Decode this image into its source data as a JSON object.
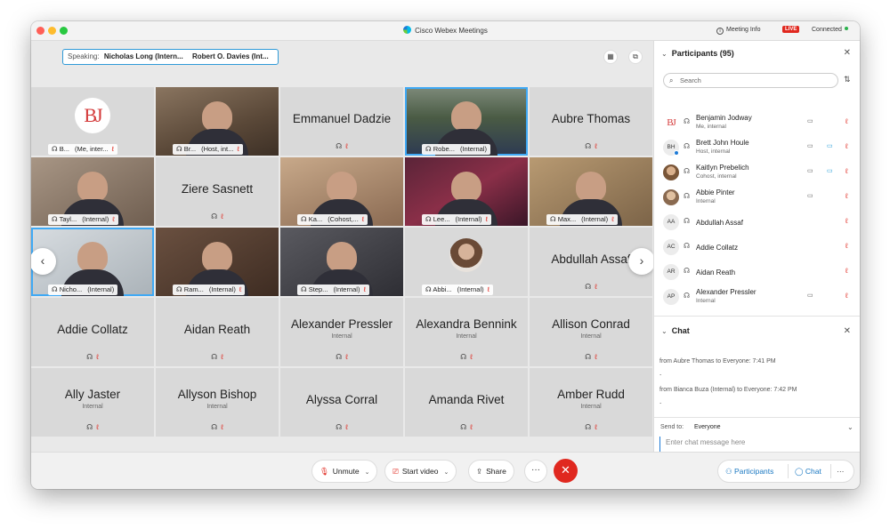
{
  "window": {
    "title": "Cisco Webex Meetings",
    "meeting_info": "Meeting Info",
    "live": "LIVE",
    "status": "Connected"
  },
  "speaking": {
    "label": "Speaking:",
    "names": [
      "Nicholas Long (Intern...",
      "Robert O. Davies (Int..."
    ]
  },
  "tiles": [
    {
      "type": "logo",
      "label": "B...",
      "extra": "(Me, inter...",
      "muted": true
    },
    {
      "type": "video",
      "label": "Br...",
      "extra": "(Host, int...",
      "muted": true
    },
    {
      "type": "name",
      "name": "Emmanuel Dadzie",
      "muted": true
    },
    {
      "type": "video",
      "label": "Robe...",
      "extra": "(Internal)",
      "muted": false
    },
    {
      "type": "name",
      "name": "Aubre Thomas",
      "muted": true
    },
    {
      "type": "video",
      "label": "Tayl...",
      "extra": "(Internal)",
      "muted": true
    },
    {
      "type": "name",
      "name": "Ziere Sasnett",
      "muted": true
    },
    {
      "type": "video",
      "label": "Ka...",
      "extra": "(Cohost,...",
      "muted": true
    },
    {
      "type": "video",
      "label": "Lee...",
      "extra": "(Internal)",
      "muted": true
    },
    {
      "type": "video",
      "label": "Max...",
      "extra": "(Internal)",
      "muted": true
    },
    {
      "type": "video",
      "label": "Nicho...",
      "extra": "(Internal)",
      "muted": false
    },
    {
      "type": "video",
      "label": "Ram...",
      "extra": "(Internal)",
      "muted": true
    },
    {
      "type": "video",
      "label": "Step...",
      "extra": "(Internal)",
      "muted": true
    },
    {
      "type": "avatar",
      "label": "Abbi...",
      "extra": "(Internal)",
      "muted": true
    },
    {
      "type": "name",
      "name": "Abdullah Assaf",
      "muted": true
    },
    {
      "type": "name",
      "name": "Addie Collatz",
      "muted": true
    },
    {
      "type": "name",
      "name": "Aidan Reath",
      "muted": true
    },
    {
      "type": "name",
      "name": "Alexander Pressler",
      "sub": "Internal",
      "muted": true
    },
    {
      "type": "name",
      "name": "Alexandra Bennink",
      "sub": "Internal",
      "muted": true
    },
    {
      "type": "name",
      "name": "Allison Conrad",
      "sub": "Internal",
      "muted": true
    },
    {
      "type": "name",
      "name": "Ally Jaster",
      "sub": "Internal",
      "muted": true
    },
    {
      "type": "name",
      "name": "Allyson Bishop",
      "sub": "Internal",
      "muted": true
    },
    {
      "type": "name",
      "name": "Alyssa Corral",
      "muted": true
    },
    {
      "type": "name",
      "name": "Amanda Rivet",
      "muted": true
    },
    {
      "type": "name",
      "name": "Amber Rudd",
      "sub": "Internal",
      "muted": true
    }
  ],
  "toolbar": {
    "unmute": "Unmute",
    "start_video": "Start video",
    "share": "Share",
    "participants": "Participants",
    "chat": "Chat"
  },
  "participants": {
    "title": "Participants (95)",
    "search_placeholder": "Search",
    "list": [
      {
        "initials": "BJ",
        "name": "Benjamin Jodway",
        "role": "Me, internal",
        "share": true,
        "cam": false
      },
      {
        "initials": "BH",
        "name": "Brett John Houle",
        "role": "Host, internal",
        "share": true,
        "cam": true
      },
      {
        "initials": "",
        "name": "Kaitlyn Prebelich",
        "role": "Cohost, internal",
        "share": true,
        "cam": true
      },
      {
        "initials": "",
        "name": "Abbie Pinter",
        "role": "Internal",
        "share": true,
        "cam": false
      },
      {
        "initials": "AA",
        "name": "Abdullah Assaf",
        "role": "",
        "share": false,
        "cam": false
      },
      {
        "initials": "AC",
        "name": "Addie Collatz",
        "role": "",
        "share": false,
        "cam": false
      },
      {
        "initials": "AR",
        "name": "Aidan Reath",
        "role": "",
        "share": false,
        "cam": false
      },
      {
        "initials": "AP",
        "name": "Alexander Pressler",
        "role": "Internal",
        "share": true,
        "cam": false
      }
    ]
  },
  "chat": {
    "title": "Chat",
    "messages": [
      {
        "meta": "from Aubre Thomas to Everyone:   7:41 PM",
        "text": "."
      },
      {
        "meta": "from Bianca Buza (Internal) to Everyone:   7:42 PM",
        "text": "."
      }
    ],
    "send_to_label": "Send to:",
    "send_to_value": "Everyone",
    "input_placeholder": "Enter chat message here"
  }
}
